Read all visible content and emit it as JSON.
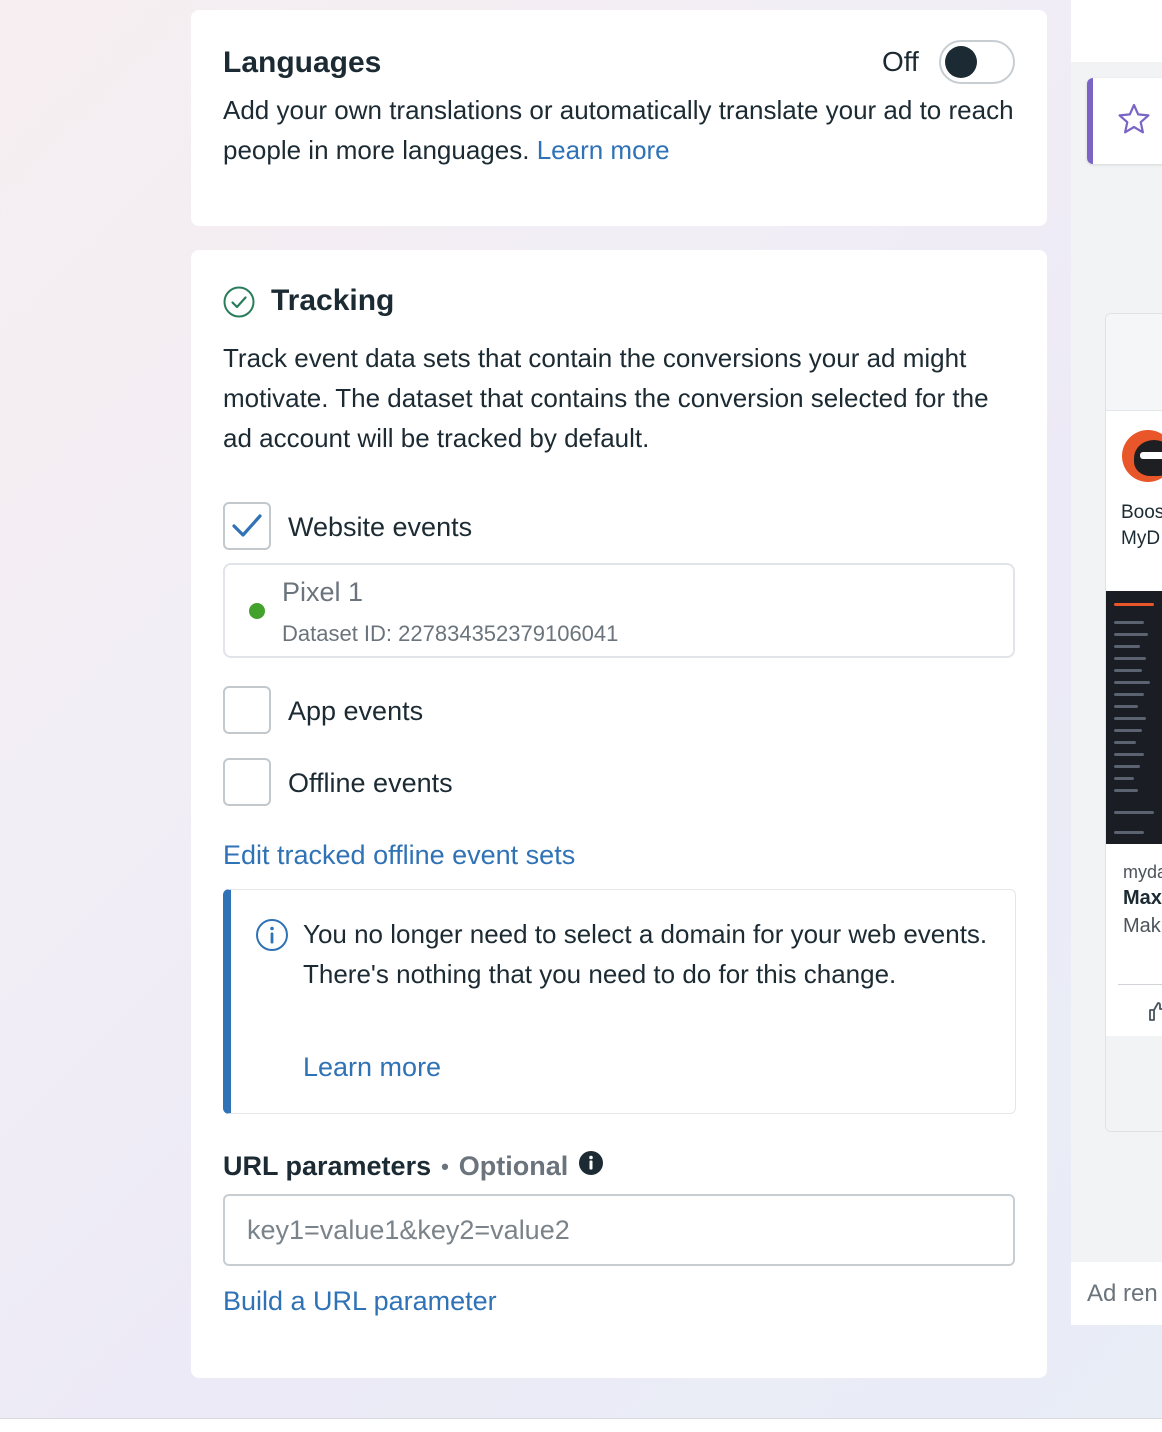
{
  "languages": {
    "title": "Languages",
    "toggle_state": "Off",
    "description": "Add your own translations or automatically translate your ad to reach people in more languages.",
    "learn_more": "Learn more"
  },
  "tracking": {
    "title": "Tracking",
    "description": "Track event data sets that contain the conversions your ad might motivate. The dataset that contains the conversion selected for the ad account will be tracked by default.",
    "website_events": {
      "label": "Website events",
      "checked": true
    },
    "pixel": {
      "name": "Pixel 1",
      "dataset_id": "Dataset ID: 227834352379106041",
      "status_color": "#42a22c"
    },
    "app_events": {
      "label": "App events",
      "checked": false
    },
    "offline_events": {
      "label": "Offline events",
      "checked": false
    },
    "edit_offline_link": "Edit tracked offline event sets",
    "info_notice": {
      "text": "You no longer need to select a domain for your web events. There's nothing that you need to do for this change.",
      "learn_more": "Learn more"
    },
    "url_parameters": {
      "label": "URL parameters",
      "separator": "•",
      "optional": "Optional",
      "placeholder": "key1=value1&key2=value2",
      "value": ""
    },
    "build_url_link": "Build a URL parameter"
  },
  "preview": {
    "ad_text_line1": "Boos",
    "ad_text_line2": "MyD",
    "ad_domain": "myda",
    "ad_headline": "Max",
    "ad_subtext": "Mak",
    "ad_render_label": "Ad ren"
  },
  "colors": {
    "link": "#2f72b5",
    "accent_purple": "#7a64c6",
    "text_primary": "#1c2b33",
    "success_green": "#42a22c"
  }
}
